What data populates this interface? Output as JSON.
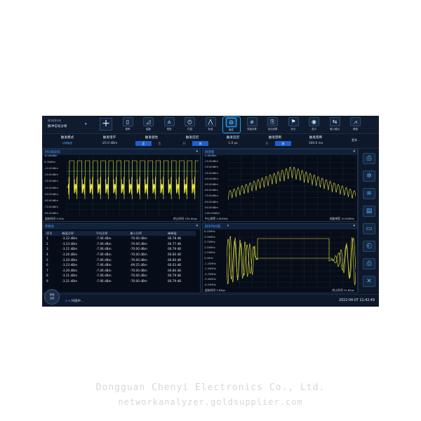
{
  "app": {
    "title": "脉冲信号分析",
    "subtitle": "脉冲信号分析",
    "add_label": "+"
  },
  "toolbar": [
    {
      "label": "频率",
      "icon": "frequency-icon",
      "glyph": "▯"
    },
    {
      "label": "幅度",
      "icon": "amplitude-icon",
      "glyph": "◿"
    },
    {
      "label": "带宽",
      "icon": "bandwidth-icon",
      "glyph": "⩟"
    },
    {
      "label": "扫描",
      "icon": "sweep-icon",
      "glyph": "◴"
    },
    {
      "label": "轨迹",
      "icon": "trace-icon",
      "glyph": "⋀"
    },
    {
      "label": "触发",
      "icon": "trigger-icon",
      "glyph": "⊙",
      "active": true
    },
    {
      "label": "测量设置",
      "icon": "measure-setup-icon",
      "glyph": "⌀"
    },
    {
      "label": "自动设置",
      "icon": "auto-setup-icon",
      "glyph": "⎘"
    },
    {
      "label": "标记",
      "icon": "marker-icon",
      "glyph": "⚑"
    },
    {
      "label": "显示",
      "icon": "display-icon",
      "glyph": "◉"
    },
    {
      "label": "输入输出",
      "icon": "io-icon",
      "glyph": "⇆"
    },
    {
      "label": "峰值",
      "icon": "peak-icon",
      "glyph": "⩘"
    }
  ],
  "params": {
    "trigger_mode": {
      "label": "触发模式",
      "value": "功率触发"
    },
    "trigger_level": {
      "label": "触发电平",
      "value": "-25.0 dBm"
    },
    "trigger_polarity": {
      "label": "触发极性",
      "on": "正",
      "off": "负"
    },
    "trigger_delay_switch": {
      "label": "触发延迟",
      "on": "开",
      "off": "关"
    },
    "trigger_delay": {
      "label": "触发延迟",
      "value": "1.0 µs"
    },
    "trigger_holdoff_switch": {
      "label": "触发阻断",
      "on": "开",
      "off": "关"
    },
    "trigger_holdoff": {
      "label": "触发阻断",
      "value": "100.0 ms"
    },
    "more": "更多..."
  },
  "panels": {
    "time_domain": {
      "title": "时间域波形",
      "y_labels": [
        "10.00dBm",
        "0.00dBm",
        "-10.00dBm",
        "-20.00dBm",
        "-30.00dBm",
        "-40.00dBm",
        "-50.00dBm",
        "-60.00dBm",
        "-70.00dBm",
        "-80.00dBm"
      ],
      "start": "起始时间 0.00s",
      "stop": "终止时间 150.00µs"
    },
    "spectrum": {
      "title": "频谱图",
      "y_labels": [
        "-0.00dBm",
        "-10.00dBm",
        "-20.00dBm",
        "-30.00dBm",
        "-40.00dBm",
        "-50.00dBm",
        "-60.00dBm",
        "-70.00dBm",
        "-80.00dBm",
        "-90.00dBm",
        "-100.00dBm"
      ],
      "center": "中心频率 2.60GHz",
      "span": "测量带宽 10.00MHz"
    },
    "stats": {
      "title": "参数表",
      "columns": [
        "序号",
        "峰值功率",
        "平均功率",
        "最小功率",
        "峰峰值"
      ],
      "rows": [
        [
          "1",
          "-3.22 dBm",
          "-7.06 dBm",
          "-70.00 dBm",
          "66.78 dB"
        ],
        [
          "2",
          "-3.23 dBm",
          "-7.06 dBm",
          "-70.00 dBm",
          "66.77 dB"
        ],
        [
          "3",
          "-3.21 dBm",
          "-7.06 dBm",
          "-70.00 dBm",
          "66.79 dB"
        ],
        [
          "4",
          "-3.20 dBm",
          "-7.06 dBm",
          "-70.00 dBm",
          "66.80 dB"
        ],
        [
          "5",
          "-3.20 dBm",
          "-7.06 dBm",
          "-70.00 dBm",
          "66.80 dB"
        ],
        [
          "6",
          "-3.23 dBm",
          "-7.06 dBm",
          "-69.25 dBm",
          "66.03 dB"
        ],
        [
          "7",
          "-3.20 dBm",
          "-7.06 dBm",
          "-70.00 dBm",
          "66.80 dB"
        ],
        [
          "8",
          "-3.21 dBm",
          "-7.06 dBm",
          "-70.00 dBm",
          "66.79 dB"
        ],
        [
          "9",
          "-3.21 dBm",
          "-7.06 dBm",
          "-70.00 dBm",
          "66.79 dB"
        ]
      ]
    },
    "freq_time": {
      "title": "频率时间图",
      "close": "✕",
      "y_labels": [
        "6.25MHz",
        "5.00MHz",
        "3.75MHz",
        "2.50MHz",
        "1.25MHz",
        "0.00Hz",
        "-1.25MHz",
        "-2.50MHz",
        "-3.75MHz",
        "-5.00MHz",
        "-6.25MHz"
      ],
      "start": "起始时间 2.88µs",
      "stop": "终止时间 12.80µs"
    }
  },
  "sidebar": [
    "save-icon",
    "settings-icon",
    "waveform-icon",
    "disk-icon",
    "folder-icon",
    "screenshot-icon",
    "print-icon",
    "exit-icon"
  ],
  "status": {
    "home_line1": "本地",
    "home_line2": "主页",
    "indicator": "⊳⊲",
    "text": "扫描中...",
    "datetime": "2022-04-07 11:42:49"
  },
  "watermark": {
    "line1": "Dongguan Chenyi Electronics Co., Ltd.",
    "line2": "networkanalyzer.goldsupplier.com"
  },
  "colors": {
    "trace": "#e8e53c",
    "accent": "#2a9ef0",
    "background": "#0b1422"
  }
}
